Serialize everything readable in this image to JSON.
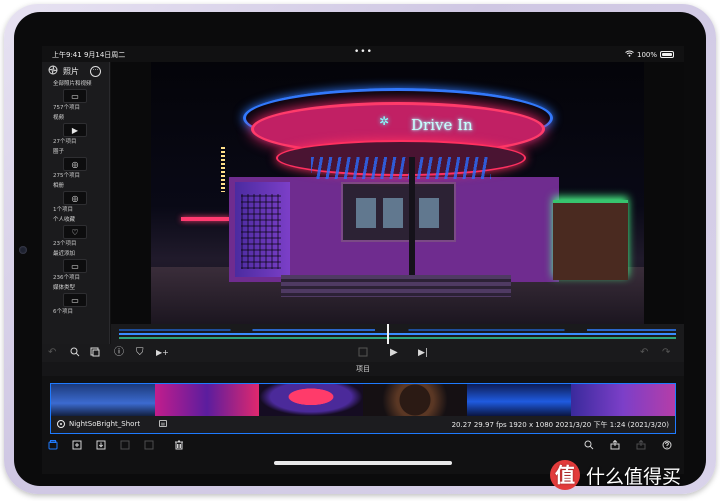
{
  "status_bar": {
    "time_date": "上午9:41  9月14日周二",
    "dots": "•••",
    "battery": "100%"
  },
  "sidebar": {
    "title": "照片",
    "icons": {
      "header": "aperture-icon",
      "more": "ellipsis-icon"
    },
    "albums": [
      {
        "title": "全部照片和视频",
        "count": "757个项目",
        "icon": "folder-icon",
        "glyph": "▭"
      },
      {
        "title": "视频",
        "count": "27个项目",
        "icon": "video-icon",
        "glyph": "▶"
      },
      {
        "title": "圈子",
        "count": "275个项目",
        "icon": "camera-icon",
        "glyph": "◎"
      },
      {
        "title": "相册",
        "count": "1个项目",
        "icon": "camera-icon",
        "glyph": "◎"
      },
      {
        "title": "个人收藏",
        "count": "23个项目",
        "icon": "heart-icon",
        "glyph": "♡"
      },
      {
        "title": "最近添加",
        "count": "236个项目",
        "icon": "folder-icon",
        "glyph": "▭"
      },
      {
        "title": "媒体类型",
        "count": "6个项目",
        "icon": "folder-icon",
        "glyph": "▭"
      }
    ]
  },
  "viewer": {
    "sign_text": "Drive In",
    "sign_stars": "✲",
    "description_icons": [
      "neon-diner-photo"
    ]
  },
  "controls": {
    "undo": "↶",
    "search": "🔍",
    "info": "ⓘ",
    "shield": "⛉",
    "add_to_timeline": "▶+",
    "play": "▶",
    "skip": "▶|",
    "redo": "↷"
  },
  "project": {
    "label": "项目"
  },
  "clip": {
    "name": "NightSoBright_Short",
    "meta": "20.27  29.97 fps  1920 x 1080  2021/3/20 下午 1:24  (2021/3/20)"
  },
  "toolbar": {
    "icons": [
      "photos-icon",
      "add-icon",
      "import-icon",
      "duplicate-icon",
      "copy-icon",
      "delete-icon",
      "search-icon",
      "share-icon",
      "export-icon",
      "help-icon"
    ]
  },
  "watermark": {
    "badge": "值",
    "text": "什么值得买"
  },
  "colors": {
    "accent": "#1f7bff",
    "screen_bg": "#111112",
    "frame": "#d9d3ea"
  }
}
